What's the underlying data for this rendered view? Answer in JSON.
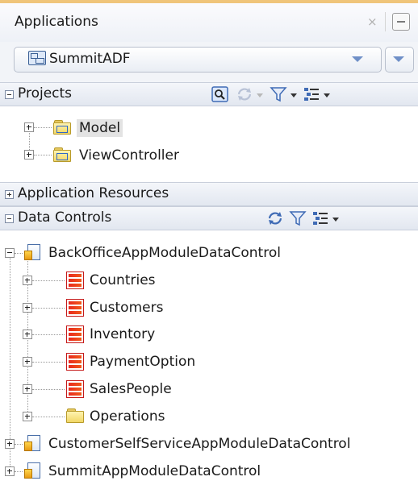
{
  "panel": {
    "title": "Applications",
    "close_icon": "×",
    "minimize_icon": "minimize-icon"
  },
  "application_selector": {
    "value": "SummitADF",
    "icon": "application-icon"
  },
  "projects": {
    "label": "Projects",
    "expanded": true,
    "toolbar": [
      "search-icon",
      "refresh-icon",
      "filter-icon",
      "view-options-icon"
    ],
    "items": [
      {
        "label": "Model",
        "icon": "project-folder-icon",
        "selected": true
      },
      {
        "label": "ViewController",
        "icon": "project-folder-icon",
        "selected": false
      }
    ]
  },
  "application_resources": {
    "label": "Application Resources",
    "expanded": false
  },
  "data_controls": {
    "label": "Data Controls",
    "expanded": true,
    "toolbar": [
      "refresh-icon",
      "filter-icon",
      "view-options-icon"
    ],
    "tree": [
      {
        "label": "BackOfficeAppModuleDataControl",
        "icon": "data-control-icon",
        "expanded": true,
        "children": [
          {
            "label": "Countries",
            "icon": "collection-icon"
          },
          {
            "label": "Customers",
            "icon": "collection-icon"
          },
          {
            "label": "Inventory",
            "icon": "collection-icon"
          },
          {
            "label": "PaymentOption",
            "icon": "collection-icon"
          },
          {
            "label": "SalesPeople",
            "icon": "collection-icon"
          },
          {
            "label": "Operations",
            "icon": "folder-icon"
          }
        ]
      },
      {
        "label": "CustomerSelfServiceAppModuleDataControl",
        "icon": "data-control-icon",
        "expanded": false
      },
      {
        "label": "SummitAppModuleDataControl",
        "icon": "data-control-icon",
        "expanded": false
      }
    ]
  },
  "colors": {
    "accent": "#6f8fc7",
    "header_gradient_top": "#f4f6fa",
    "header_gradient_bottom": "#e2e7f0",
    "collection_red": "#e8281e",
    "selection": "#e3e3e3"
  }
}
